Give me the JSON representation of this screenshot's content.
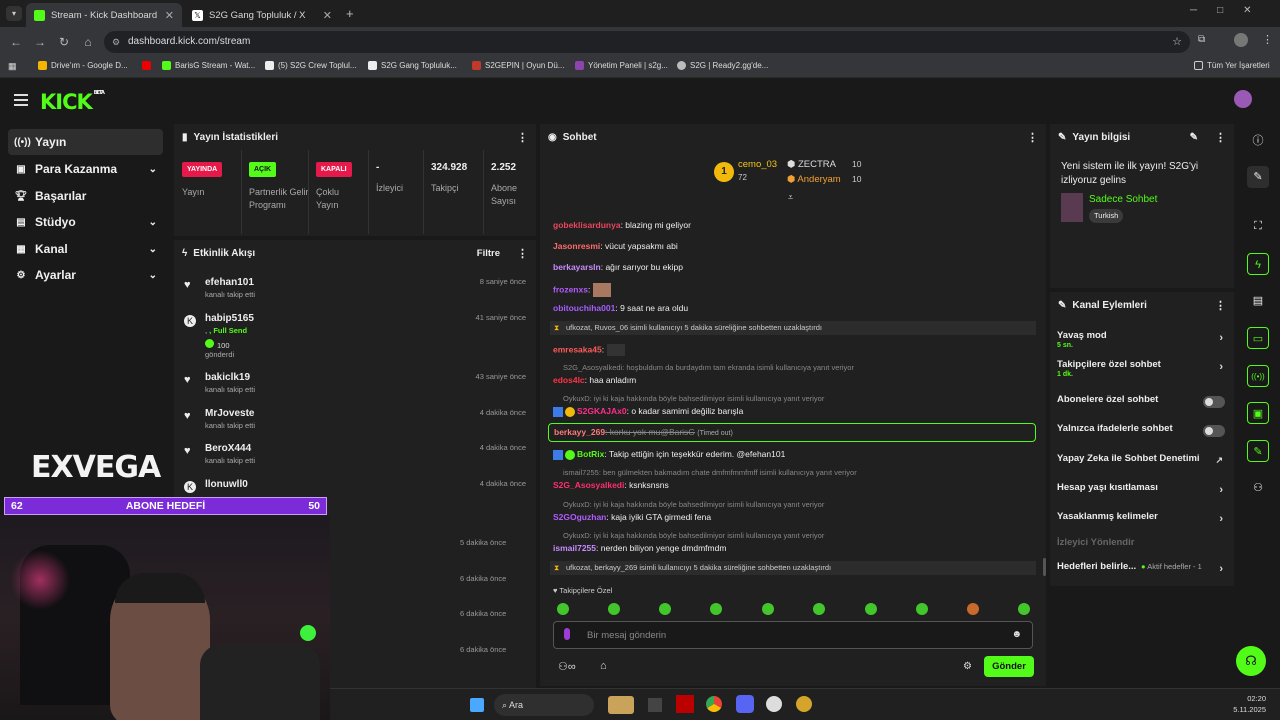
{
  "tabs": [
    {
      "label": "Stream - Kick Dashboard"
    },
    {
      "label": "S2G Gang Topluluk / X"
    }
  ],
  "address": "dashboard.kick.com/stream",
  "bookmarks": [
    "Drive'ım - Google D...",
    "BarisG Stream - Wat...",
    "(5) S2G Crew Toplul...",
    "S2G Gang Topluluk...",
    "S2GEPIN | Oyun Dü...",
    "Yönetim Paneli | s2g...",
    "S2G | Ready2.gg'de...",
    "Tüm Yer İşaretleri"
  ],
  "logo": "KICK",
  "logo_beta": "BETA",
  "nav": [
    {
      "label": "Yayın"
    },
    {
      "label": "Para Kazanma"
    },
    {
      "label": "Başarılar"
    },
    {
      "label": "Stüdyo"
    },
    {
      "label": "Kanal"
    },
    {
      "label": "Ayarlar"
    }
  ],
  "stats": {
    "title": "Yayın İstatistikleri",
    "items": [
      {
        "badge": "YAYINDA",
        "label": "Yayın"
      },
      {
        "badge": "AÇIK",
        "label": "Partnerlik Gelir Programı"
      },
      {
        "badge": "KAPALI",
        "label": "Çoklu Yayın"
      },
      {
        "value": "-",
        "label": "İzleyici"
      },
      {
        "value": "324.928",
        "label": "Takipçi"
      },
      {
        "value": "2.252",
        "label": "Abone Sayısı"
      }
    ]
  },
  "activity": {
    "title": "Etkinlik Akışı",
    "filter": "Filtre",
    "events": [
      {
        "name": "efehan101",
        "sub": "kanalı takip etti",
        "time": "8 saniye önce"
      },
      {
        "name": "habip5165",
        "sub": ", Full Send",
        "amount": "100",
        "sub2": "gönderdi",
        "time": "41 saniye önce"
      },
      {
        "name": "bakiclk19",
        "sub": "kanalı takip etti",
        "time": "43 saniye önce"
      },
      {
        "name": "MrJoveste",
        "sub": "kanalı takip etti",
        "time": "4 dakika önce"
      },
      {
        "name": "BeroX444",
        "sub": "kanalı takip etti",
        "time": "4 dakika önce"
      },
      {
        "name": "llonuwll0",
        "sub": "",
        "time": "4 dakika önce"
      }
    ],
    "more_times": [
      "5 dakika önce",
      "6 dakika önce",
      "6 dakika önce",
      "6 dakika önce"
    ]
  },
  "goal": {
    "left": "62",
    "label": "ABONE HEDEFİ",
    "right": "50"
  },
  "watermark": "EXVEGA",
  "chat": {
    "title": "Sohbet",
    "top": [
      {
        "rank": "1",
        "name": "cemo_03",
        "count": "72"
      },
      {
        "name": "ZECTRA",
        "count": "10"
      },
      {
        "name": "Anderyam",
        "count": "10"
      }
    ],
    "messages": [
      {
        "user": "gobeklisardunya",
        "text": ": blazing mi geliyor"
      },
      {
        "user": "Jasonresmi",
        "text": ": vücut yapsakmı abi"
      },
      {
        "user": "berkayarsln",
        "text": ": ağır sarıyor bu ekipp"
      },
      {
        "user": "frozenxs",
        "text": ":"
      },
      {
        "user": "obitouchiha001",
        "text": ": 9 saat ne ara oldu"
      },
      {
        "sys": "ufkozat, Ruvos_06 isimli kullanıcıyı 5 dakika süreliğine sohbetten uzaklaştırdı"
      },
      {
        "user": "emresaka45",
        "text": ":"
      },
      {
        "reply": "S2G_Asosyalkedi: hoşbuldum da burdaydım tam ekranda  isimli kullanıcıya yanıt veriyor"
      },
      {
        "user": "edos4lc",
        "text": ": haa anladım"
      },
      {
        "reply": "OykuxD: iyi ki kaja hakkında böyle bahsedilmiyor isimli kullanıcıya yanıt veriyor"
      },
      {
        "user": "S2GKAJAx0",
        "text": ": o kadar samimi değiliz barışla"
      },
      {
        "timeout_user": "berkayy_269",
        "timeout_text": ": korku yok mu@BarisG",
        "timeout_tag": "(Timed out)"
      },
      {
        "user": "BotRix",
        "text": ": Takip ettiğin için teşekkür ederim.  @efehan101"
      },
      {
        "reply": "ismail7255: ben gülmekten bakmadım chate dmfmfmmfmff isimli kullanıcıya yanıt veriyor"
      },
      {
        "user": "S2G_Asosyalkedi",
        "text": ": ksnksnsns"
      },
      {
        "reply": "OykuxD: iyi ki kaja hakkında böyle bahsedilmiyor isimli kullanıcıya yanıt veriyor"
      },
      {
        "user": "S2GOguzhan",
        "text": ": kaja iyiki GTA girmedi  fena"
      },
      {
        "reply": "OykuxD: iyi ki kaja hakkında böyle bahsedilmiyor isimli kullanıcıya yanıt veriyor"
      },
      {
        "user": "ismail7255",
        "text": ": nerden biliyon yenge dmdmfmdm"
      },
      {
        "sys": "ufkozat, berkayy_269 isimli kullanıcıyı 5 dakika süreliğine sohbetten uzaklaştırdı"
      }
    ],
    "followers_label": "Takipçilere Özel",
    "placeholder": "Bir mesaj gönderin",
    "send": "Gönder"
  },
  "info": {
    "title": "Yayın bilgisi",
    "stream_title": "Yeni sistem ile ilk yayın! S2G'yi izliyoruz gelins",
    "category": "Sadece Sohbet",
    "language": "Turkish"
  },
  "actions": {
    "title": "Kanal Eylemleri",
    "items": [
      {
        "label": "Yavaş mod",
        "sub": "5 sn."
      },
      {
        "label": "Takipçilere özel sohbet",
        "sub": "1 dk."
      },
      {
        "label": "Abonelere özel sohbet"
      },
      {
        "label": "Yalnızca ifadelerle sohbet"
      },
      {
        "label": "Yapay Zeka ile Sohbet Denetimi"
      },
      {
        "label": "Hesap yaşı kısıtlaması"
      },
      {
        "label": "Yasaklanmış kelimeler"
      },
      {
        "label": "İzleyici Yönlendir"
      },
      {
        "label": "Hedefleri belirle...",
        "sub": "Aktif hedefler - 1"
      }
    ]
  },
  "taskbar": {
    "search": "Ara",
    "time": "02:20",
    "date": "5.11.2025"
  },
  "colors": {
    "kick_green": "#53fc18",
    "live_red": "#e6194b",
    "goal_purple": "#7c2bd8"
  }
}
